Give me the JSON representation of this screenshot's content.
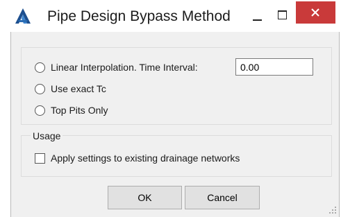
{
  "window": {
    "title": "Pipe Design Bypass Method",
    "icons": {
      "app": "autocad-a-icon",
      "minimize": "minimize-icon",
      "maximize": "maximize-icon",
      "close": "close-icon"
    },
    "close_color": "#c93a3a"
  },
  "method": {
    "options": [
      {
        "label": "Linear Interpolation. Time Interval:",
        "selected": false
      },
      {
        "label": "Use exact Tc",
        "selected": false
      },
      {
        "label": "Top Pits Only",
        "selected": false
      }
    ],
    "time_interval_value": "0.00"
  },
  "usage": {
    "legend": "Usage",
    "apply_existing_label": "Apply settings to existing drainage networks",
    "apply_existing_checked": false
  },
  "buttons": {
    "ok": "OK",
    "cancel": "Cancel"
  }
}
